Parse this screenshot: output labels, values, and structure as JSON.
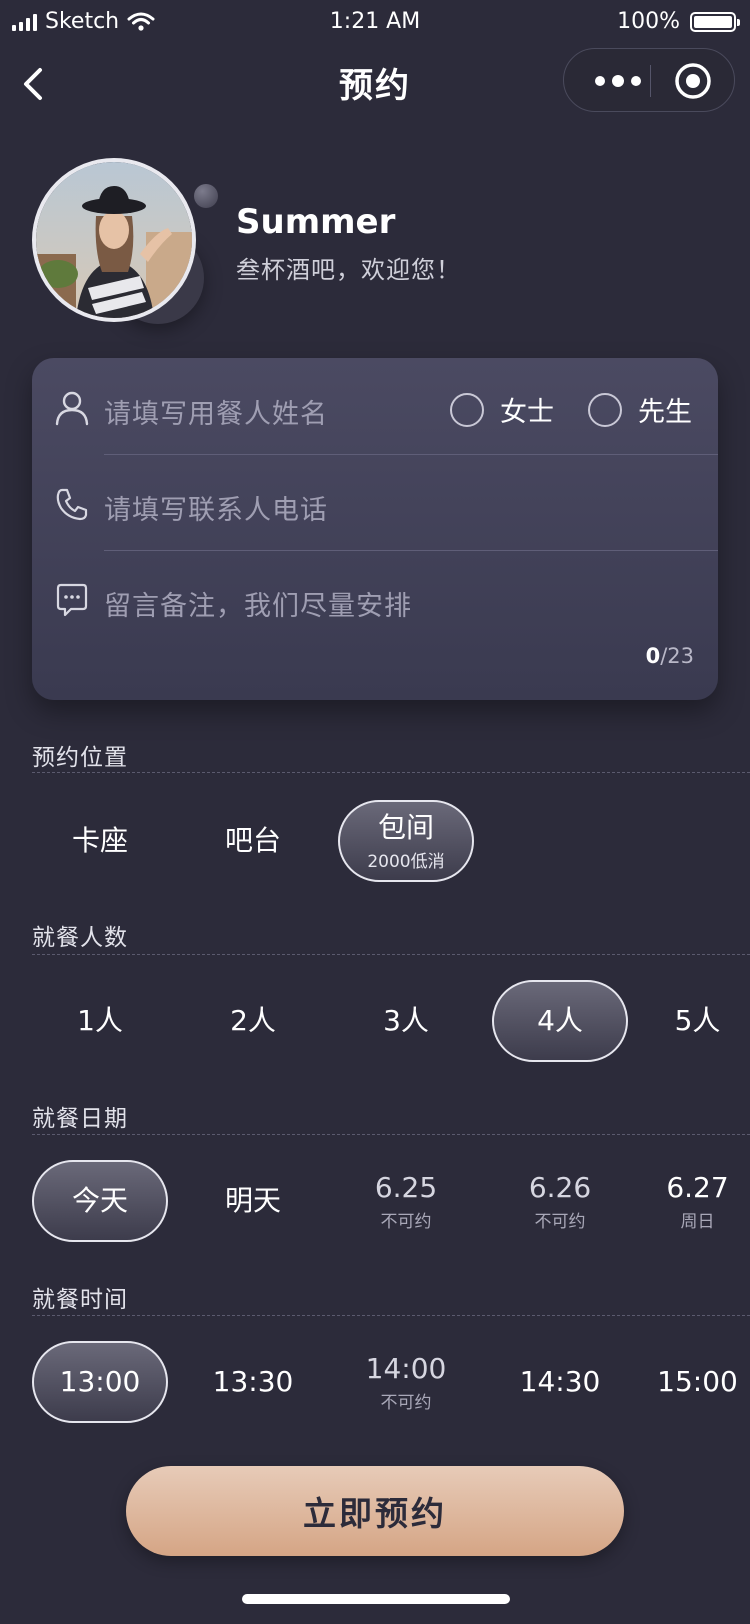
{
  "status_bar": {
    "carrier": "Sketch",
    "time": "1:21 AM",
    "battery": "100%"
  },
  "nav": {
    "title": "预约"
  },
  "profile": {
    "name": "Summer",
    "greeting": "叁杯酒吧，欢迎您！"
  },
  "form": {
    "name_placeholder": "请填写用餐人姓名",
    "gender_options": [
      "女士",
      "先生"
    ],
    "phone_placeholder": "请填写联系人电话",
    "remark_placeholder": "留言备注，我们尽量安排",
    "remark_count": "0",
    "remark_max": "/23"
  },
  "sections": {
    "location": {
      "title": "预约位置",
      "options": [
        {
          "label": "卡座",
          "sub": ""
        },
        {
          "label": "吧台",
          "sub": ""
        },
        {
          "label": "包间",
          "sub": "2000低消",
          "selected": true
        }
      ]
    },
    "people": {
      "title": "就餐人数",
      "options": [
        {
          "label": "1人"
        },
        {
          "label": "2人"
        },
        {
          "label": "3人"
        },
        {
          "label": "4人",
          "selected": true
        },
        {
          "label": "5人"
        }
      ]
    },
    "date": {
      "title": "就餐日期",
      "options": [
        {
          "label": "今天",
          "sub": "",
          "selected": true
        },
        {
          "label": "明天",
          "sub": ""
        },
        {
          "label": "6.25",
          "sub": "不可约"
        },
        {
          "label": "6.26",
          "sub": "不可约"
        },
        {
          "label": "6.27",
          "sub": "周日"
        }
      ]
    },
    "time": {
      "title": "就餐时间",
      "options": [
        {
          "label": "13:00",
          "sub": "",
          "selected": true
        },
        {
          "label": "13:30",
          "sub": ""
        },
        {
          "label": "14:00",
          "sub": "不可约"
        },
        {
          "label": "14:30",
          "sub": ""
        },
        {
          "label": "15:00",
          "sub": ""
        }
      ]
    }
  },
  "submit_label": "立即预约",
  "colors": {
    "background": "#2c2b3a",
    "accent": "#d5a585",
    "card": "#454460"
  }
}
